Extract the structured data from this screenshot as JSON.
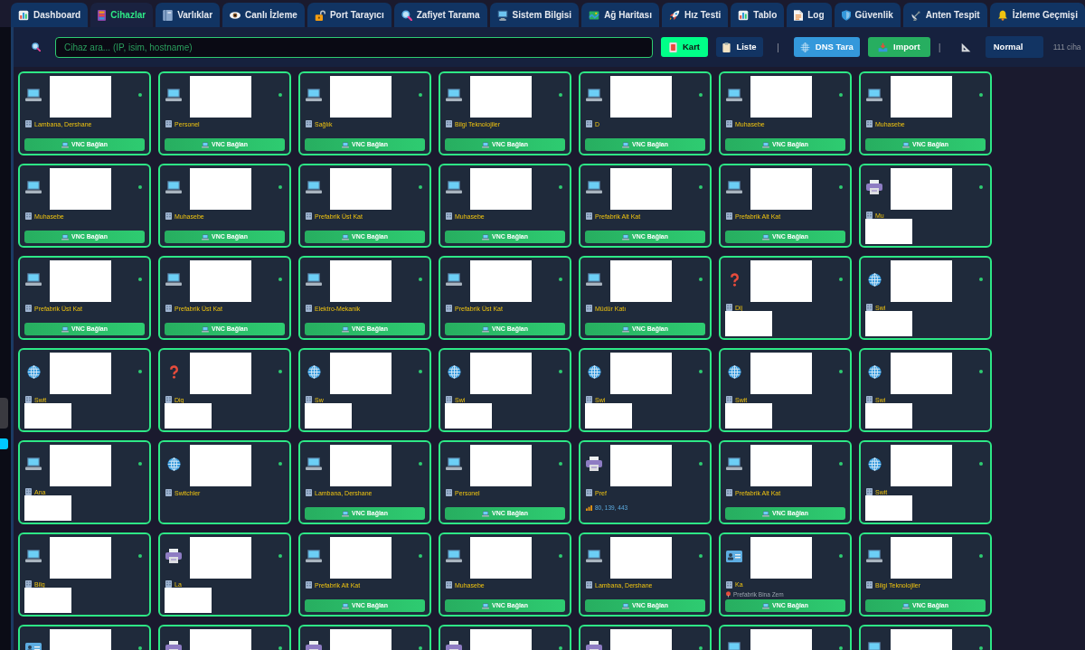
{
  "tabs": [
    {
      "label": "Dashboard",
      "selected": false
    },
    {
      "label": "Cihazlar",
      "selected": true
    },
    {
      "label": "Varlıklar",
      "selected": false
    },
    {
      "label": "Canlı İzleme",
      "selected": false
    },
    {
      "label": "Port Tarayıcı",
      "selected": false
    },
    {
      "label": "Zafiyet Tarama",
      "selected": false
    },
    {
      "label": "Sistem Bilgisi",
      "selected": false
    },
    {
      "label": "Ağ Haritası",
      "selected": false
    },
    {
      "label": "Hız Testi",
      "selected": false
    },
    {
      "label": "Tablo",
      "selected": false
    },
    {
      "label": "Log",
      "selected": false
    },
    {
      "label": "Güvenlik",
      "selected": false
    },
    {
      "label": "Anten Tespit",
      "selected": false
    },
    {
      "label": "İzleme Geçmişi",
      "selected": false
    }
  ],
  "toolbar": {
    "search": {
      "placeholder": "Cihaz ara... (IP, isim, hostname)"
    },
    "view_buttons": [
      {
        "label": "Kart",
        "selected": true
      },
      {
        "label": "Liste",
        "selected": false
      }
    ],
    "separator_1": "|",
    "action_buttons": [
      {
        "label": "DNS Tara",
        "color": "#3498db"
      },
      {
        "label": "Import",
        "color": "#27ae60"
      }
    ],
    "separator_2": "|",
    "size_select": {
      "value": "Normal"
    },
    "device_count": "111 ciha"
  },
  "devices": [
    {
      "kind": "laptop",
      "online": true,
      "location": "Lambana, Dershane",
      "vnc_button": "VNC Bağlan"
    },
    {
      "kind": "laptop",
      "online": true,
      "location": "Personel",
      "vnc_button": "VNC Bağlan"
    },
    {
      "kind": "laptop",
      "online": true,
      "location": "Sağlık",
      "vnc_button": "VNC Bağlan"
    },
    {
      "kind": "laptop",
      "online": true,
      "location": "Bilgi Teknolojiler",
      "vnc_button": "VNC Bağlan"
    },
    {
      "kind": "laptop",
      "online": true,
      "location": "D",
      "vnc_button": "VNC Bağlan"
    },
    {
      "kind": "laptop",
      "online": true,
      "location": "Muhasebe",
      "vnc_button": "VNC Bağlan"
    },
    {
      "kind": "laptop",
      "online": true,
      "location": "Muhasebe",
      "vnc_button": "VNC Bağlan"
    },
    {
      "kind": "laptop",
      "online": true,
      "location": "Muhasebe",
      "vnc_button": "VNC Bağlan"
    },
    {
      "kind": "laptop",
      "online": true,
      "location": "Muhasebe",
      "vnc_button": "VNC Bağlan"
    },
    {
      "kind": "laptop",
      "online": true,
      "location": "Prefabrik Üst Kat",
      "vnc_button": "VNC Bağlan"
    },
    {
      "kind": "laptop",
      "online": true,
      "location": "Muhasebe",
      "vnc_button": "VNC Bağlan"
    },
    {
      "kind": "laptop",
      "online": true,
      "location": "Prefabrik Alt Kat",
      "vnc_button": "VNC Bağlan"
    },
    {
      "kind": "laptop",
      "online": true,
      "location": "Prefabrik Alt Kat",
      "vnc_button": "VNC Bağlan"
    },
    {
      "kind": "printer",
      "online": true,
      "location": "Mu",
      "lower_redacted": true
    },
    {
      "kind": "laptop",
      "online": true,
      "location": "Prefabrik Üst Kat",
      "vnc_button": "VNC Bağlan"
    },
    {
      "kind": "laptop",
      "online": true,
      "location": "Prefabrik Üst Kat",
      "vnc_button": "VNC Bağlan"
    },
    {
      "kind": "laptop",
      "online": true,
      "location": "Elektro-Mekanik",
      "vnc_button": "VNC Bağlan"
    },
    {
      "kind": "laptop",
      "online": true,
      "location": "Prefabrik Üst Kat",
      "vnc_button": "VNC Bağlan"
    },
    {
      "kind": "laptop",
      "online": true,
      "location": "Müdür Katı",
      "vnc_button": "VNC Bağlan"
    },
    {
      "kind": "unknown",
      "online": true,
      "location": "Dij",
      "lower_redacted": true
    },
    {
      "kind": "globe",
      "online": true,
      "location": "Swi",
      "lower_redacted": true
    },
    {
      "kind": "globe",
      "online": true,
      "location": "Swit",
      "lower_redacted": true
    },
    {
      "kind": "unknown",
      "online": true,
      "location": "Dig",
      "lower_redacted": true
    },
    {
      "kind": "globe",
      "online": true,
      "location": "Sw",
      "lower_redacted": true
    },
    {
      "kind": "globe",
      "online": true,
      "location": "Swi",
      "lower_redacted": true
    },
    {
      "kind": "globe",
      "online": true,
      "location": "Swi",
      "lower_redacted": true
    },
    {
      "kind": "globe",
      "online": true,
      "location": "Swit",
      "lower_redacted": true
    },
    {
      "kind": "globe",
      "online": true,
      "location": "Swi",
      "lower_redacted": true
    },
    {
      "kind": "laptop",
      "online": true,
      "location": "Ana",
      "lower_redacted": true
    },
    {
      "kind": "globe",
      "online": true,
      "location": "Switchler"
    },
    {
      "kind": "laptop",
      "online": true,
      "location": "Lambana, Dershane",
      "vnc_button": "VNC Bağlan"
    },
    {
      "kind": "laptop",
      "online": true,
      "location": "Personel",
      "vnc_button": "VNC Bağlan"
    },
    {
      "kind": "printer",
      "online": true,
      "location": "Pref",
      "ports": "80, 139, 443"
    },
    {
      "kind": "laptop",
      "online": true,
      "location": "Prefabrik Alt Kat",
      "vnc_button": "VNC Bağlan"
    },
    {
      "kind": "globe",
      "online": true,
      "location": "Swit",
      "lower_redacted": true
    },
    {
      "kind": "laptop",
      "online": true,
      "location": "Bilg",
      "lower_redacted": true
    },
    {
      "kind": "printer",
      "online": true,
      "location": "La",
      "lower_redacted": true
    },
    {
      "kind": "laptop",
      "online": true,
      "location": "Prefabrik Alt Kat",
      "vnc_button": "VNC Bağlan"
    },
    {
      "kind": "laptop",
      "online": true,
      "location": "Muhasebe",
      "vnc_button": "VNC Bağlan"
    },
    {
      "kind": "laptop",
      "online": true,
      "location": "Lambana, Dershane",
      "vnc_button": "VNC Bağlan"
    },
    {
      "kind": "id_card",
      "online": true,
      "location": "Ka",
      "sublocation": "Prefabrik Bina Zem",
      "vnc_button": "VNC Bağlan"
    },
    {
      "kind": "laptop",
      "online": true,
      "location": "Bilgi Teknolojiler",
      "vnc_button": "VNC Bağlan"
    },
    {
      "kind": "id_card",
      "online": true
    },
    {
      "kind": "printer",
      "online": true
    },
    {
      "kind": "printer",
      "online": true
    },
    {
      "kind": "printer",
      "online": true
    },
    {
      "kind": "printer",
      "online": true
    },
    {
      "kind": "laptop",
      "online": true
    },
    {
      "kind": "laptop",
      "online": true
    }
  ]
}
